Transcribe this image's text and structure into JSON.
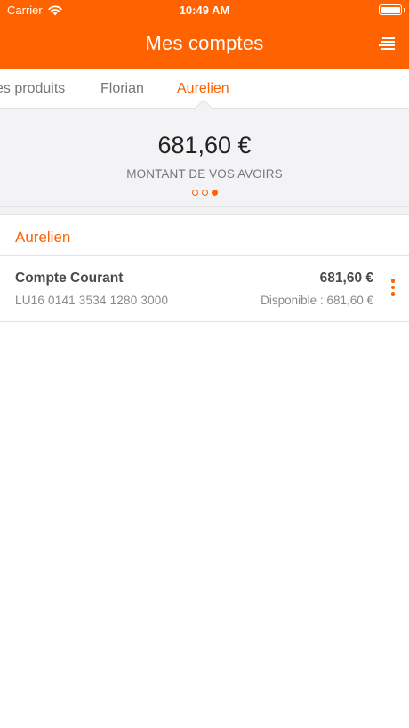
{
  "status_bar": {
    "carrier": "Carrier",
    "time": "10:49 AM",
    "wifi_icon": "wifi-icon",
    "battery_icon": "battery-icon"
  },
  "header": {
    "title": "Mes comptes",
    "menu_icon": "menu-icon",
    "brand_color": "#ff6200"
  },
  "tabs": [
    {
      "label": "es produits",
      "active": false
    },
    {
      "label": "Florian",
      "active": false
    },
    {
      "label": "Aurelien",
      "active": true
    }
  ],
  "summary": {
    "total": "681,60 €",
    "label": "MONTANT DE VOS AVOIRS",
    "pages": 3,
    "active_page": 3
  },
  "section": {
    "title": "Aurelien"
  },
  "accounts": [
    {
      "name": "Compte Courant",
      "iban": "LU16 0141 3534 1280 3000",
      "balance": "681,60  €",
      "available": "Disponible : 681,60  €",
      "more_icon": "more-vertical-icon"
    }
  ]
}
